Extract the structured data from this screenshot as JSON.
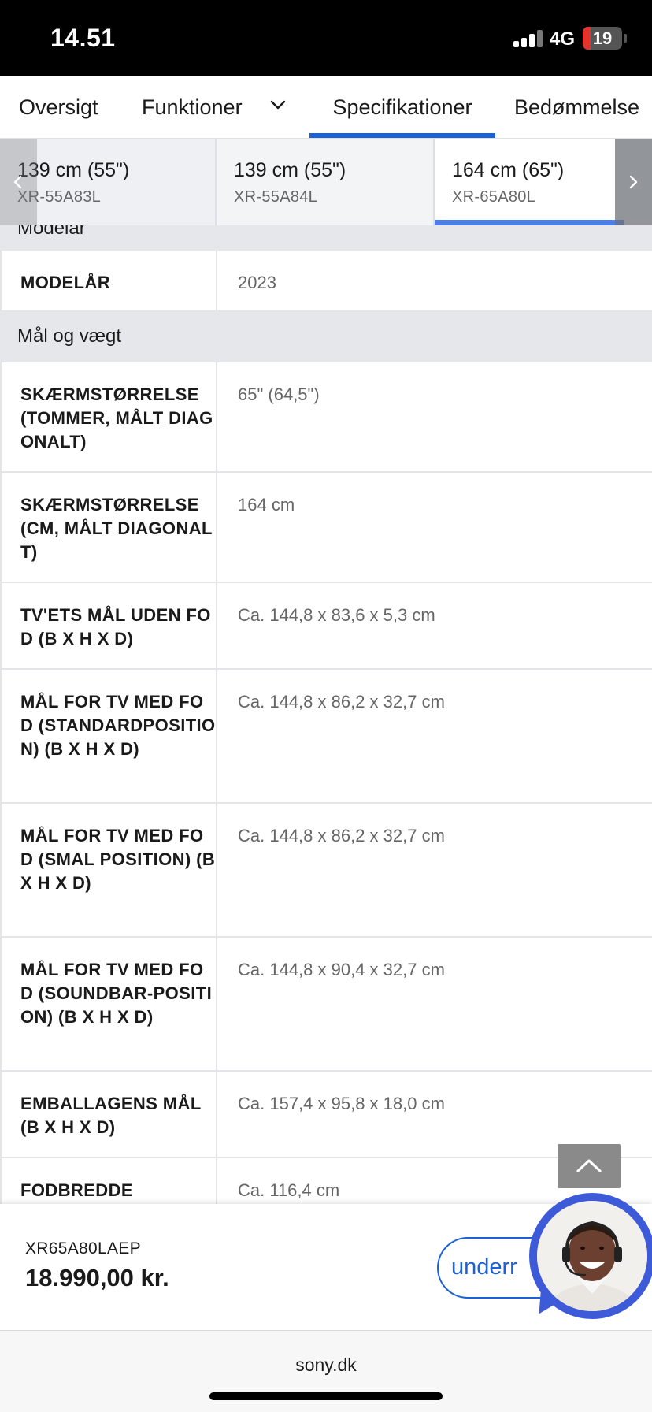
{
  "status_bar": {
    "time": "14.51",
    "network": "4G",
    "battery": "19",
    "battery_level": 0.19
  },
  "tabs": [
    {
      "label": "Oversigt"
    },
    {
      "label": "Funktioner",
      "icon": "chevron-down-icon"
    },
    {
      "label": "Specifikationer",
      "active": true
    },
    {
      "label": "Bedømmelse"
    }
  ],
  "models": [
    {
      "size": "139 cm (55\")",
      "code": "XR-55A83L"
    },
    {
      "size": "139 cm (55\")",
      "code": "XR-55A84L"
    },
    {
      "size": "164 cm (65\")",
      "code": "XR-65A80L",
      "selected": true
    }
  ],
  "spec_sections": {
    "partial_header": "Modelår",
    "model_year": {
      "label": "MODELÅR",
      "value": "2023"
    },
    "dimensions_header": "Mål og vægt",
    "rows": [
      {
        "label": "SKÆRMSTØRRELSE (TOMMER, MÅLT DIAGONALT)",
        "value": "65\" (64,5\")"
      },
      {
        "label": "SKÆRMSTØRRELSE (CM, MÅLT DIAGONALT)",
        "value": "164 cm"
      },
      {
        "label": "TV'ETS MÅL UDEN FOD (B X H X D)",
        "value": "Ca. 144,8 x 83,6 x 5,3 cm"
      },
      {
        "label": "MÅL FOR TV MED FOD (STANDARDPOSITION) (B X H X D)",
        "value": "Ca. 144,8 x 86,2 x 32,7 cm"
      },
      {
        "label": "MÅL FOR TV MED FOD (SMAL POSITION) (B X H X D)",
        "value": "Ca. 144,8 x 86,2 x 32,7 cm"
      },
      {
        "label": "MÅL FOR TV MED FOD (SOUNDBAR-POSITION) (B X H X D)",
        "value": "Ca. 144,8 x 90,4 x 32,7 cm"
      },
      {
        "label": "EMBALLAGENS MÅL (B X H X D)",
        "value": "Ca. 157,4 x 95,8 x 18,0 cm"
      },
      {
        "label": "FODBREDDE",
        "value": "Ca. 116,4 cm"
      }
    ]
  },
  "purchase": {
    "sku": "XR65A80LAEP",
    "price": "18.990,00 kr.",
    "notify_label": "underr"
  },
  "browser": {
    "url": "sony.dk"
  },
  "colors": {
    "accent": "#1a62d8",
    "section_bg": "#e5e7eb",
    "chat_ring": "#3d5bd9"
  }
}
